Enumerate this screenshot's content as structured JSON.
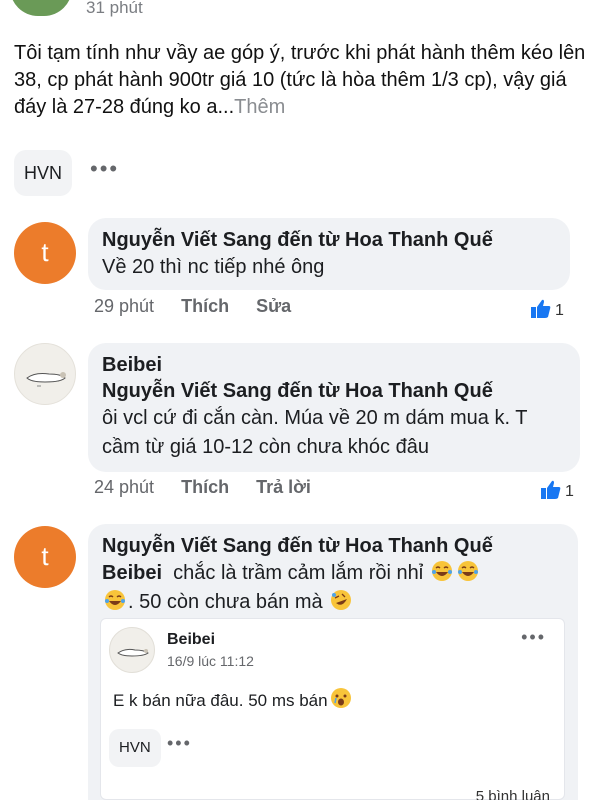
{
  "header": {
    "time": "31 phút"
  },
  "post": {
    "text": "Tôi tạm tính như vầy ae góp ý, trước khi phát hành thêm kéo lên 38, cp phát hành 900tr giá 10 (tức là hòa thêm 1/3 cp), vậy giá đáy là 27-28 đúng ko a...",
    "more": "Thêm",
    "chip": "HVN",
    "dots": "•••"
  },
  "comments": [
    {
      "avatar_letter": "t",
      "name": "Nguyễn Viết Sang đến từ Hoa Thanh Quế",
      "text": "Về 20 thì nc tiếp nhé ông",
      "time": "29 phút",
      "like_label": "Thích",
      "action_label": "Sửa",
      "like_count": "1"
    },
    {
      "name_line1": "Beibei",
      "name": "Nguyễn Viết Sang đến từ Hoa Thanh Quế",
      "text": "ôi vcl cứ đi cắn càn. Múa về 20 m dám mua k. T cầm từ giá 10-12 còn chưa khóc đâu",
      "time": "24 phút",
      "like_label": "Thích",
      "action_label": "Trả lời",
      "like_count": "1"
    },
    {
      "avatar_letter": "t",
      "name": "Nguyễn Viết Sang đến từ Hoa Thanh Quế",
      "mention": "Beibei",
      "text1": "chắc là trầm cảm lắm rồi nhỉ",
      "text2": ". 50 còn chưa bán mà",
      "shared": {
        "name": "Beibei",
        "date": "16/9 lúc 11:12",
        "dots": "•••",
        "text": "E k bán nữa đâu. 50 ms bán",
        "chip": "HVN",
        "chip_dots": "•••",
        "comments_count": "5 bình luận"
      }
    }
  ],
  "colors": {
    "avatar_orange": "#ec7c2b",
    "bubble_bg": "#f0f2f5",
    "like_blue": "#1877f2",
    "meta_gray": "#65676b"
  }
}
